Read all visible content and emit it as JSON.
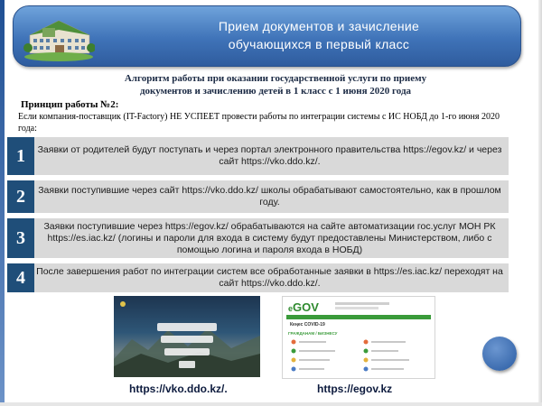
{
  "banner": {
    "title_line1": "Прием документов и зачисление",
    "title_line2": "обучающихся в первый класс"
  },
  "subtitle": {
    "line1": "Алгоритм работы при оказании государственной услуги по приему",
    "line2": "документов и зачислению детей в 1 класс с 1 июня 2020 года"
  },
  "principle": "Принцип работы №2:",
  "condition": "Если компания-поставщик (IT-Factory) НЕ УСПЕЕТ провести работы по интеграции системы с ИС НОБД до 1-го июня 2020 года:",
  "steps": [
    {
      "number": "1",
      "text": "Заявки от родителей будут поступать и через портал электронного правительства https://egov.kz/ и через сайт https://vko.ddo.kz/."
    },
    {
      "number": "2",
      "text": "Заявки поступившие через сайт https://vko.ddo.kz/ школы обрабатывают самостоятельно, как в прошлом году."
    },
    {
      "number": "3",
      "text": "Заявки поступившие через https://egov.kz/ обрабатываются на сайте автоматизации гос.услуг МОН РК https://es.iac.kz/ (логины и пароли для входа в систему будут предоставлены Министерством, либо с помощью логина и пароля входа в НОБД)"
    },
    {
      "number": "4",
      "text": "После завершения работ по интеграции систем все обработанные заявки в https://es.iac.kz/ переходят на сайт https://vko.ddo.kz/."
    }
  ],
  "screens": {
    "egov_logo_e": "e",
    "egov_logo_gov": "GOV",
    "egov_badge": "Кеңес COVID-19",
    "egov_section": "ГРАЖДАНАМ / БИЗНЕСУ"
  },
  "captions": {
    "vko": "https://vko.ddo.kz/.",
    "egov": "https://egov.kz"
  },
  "colors": {
    "banner": "#3f73b8",
    "step_number_bg": "#1f4e79",
    "step_bg": "#d9d9d9",
    "egov_green": "#3a9b3a"
  }
}
